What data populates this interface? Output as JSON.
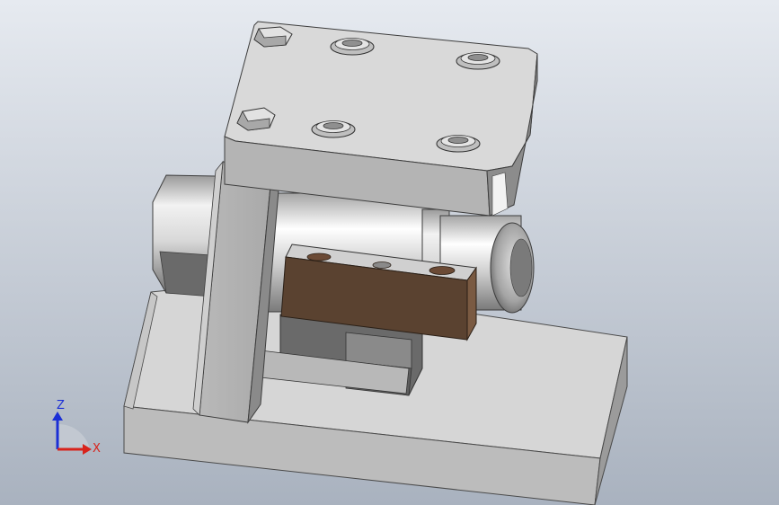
{
  "view": {
    "background_top": "#e6eaf0",
    "background_bottom": "#a9b2bf"
  },
  "triad": {
    "z_label": "Z",
    "x_label": "X",
    "z_color": "#1b2fd6",
    "x_color": "#d8231c"
  },
  "model": {
    "icons": [
      "cad-3d-assembly"
    ],
    "colors": {
      "light_face": "#dcdcdc",
      "mid_face": "#b7b7b7",
      "dark_face": "#8a8a8a",
      "darker_face": "#6f6f6f",
      "block_brown": "#5a4230"
    }
  }
}
